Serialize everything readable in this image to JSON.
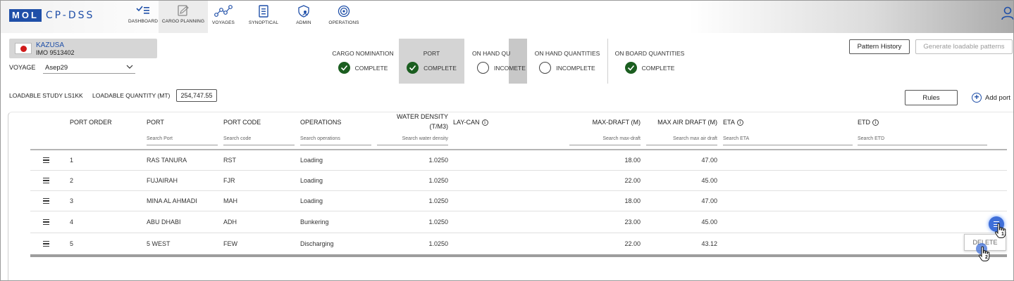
{
  "brand": {
    "logo_box": "MOL",
    "logo_text": "CP-DSS"
  },
  "nav": [
    {
      "label": "DASHBOARD",
      "icon": "checklist-icon"
    },
    {
      "label": "CARGO PLANNING",
      "icon": "clipboard-edit-icon"
    },
    {
      "label": "VOYAGES",
      "icon": "route-nodes-icon"
    },
    {
      "label": "SYNOPTICAL",
      "icon": "report-icon"
    },
    {
      "label": "ADMIN",
      "icon": "shield-user-icon"
    },
    {
      "label": "OPERATIONS",
      "icon": "target-icon"
    }
  ],
  "vessel": {
    "name": "KAZUSA",
    "imo": "IMO 9513402",
    "flag": "japan-flag-icon"
  },
  "voyage": {
    "label": "VOYAGE",
    "value": "Asep29"
  },
  "steps": [
    {
      "title": "CARGO NOMINATION",
      "status": "COMPLETE"
    },
    {
      "title": "PORT",
      "status": "COMPLETE"
    },
    {
      "title": "ON HAND QU",
      "status": "INCOMETE"
    },
    {
      "title": "ON HAND QUANTITIES",
      "status": "INCOMPLETE"
    },
    {
      "title": "ON BOARD QUANTITIES",
      "status": "COMPLETE"
    }
  ],
  "buttons": {
    "pattern_history": "Pattern History",
    "generate": "Generate loadable patterns",
    "rules": "Rules",
    "add_port": "Add port"
  },
  "study": {
    "label": "LOADABLE STUDY LS1KK",
    "quantity_label": "LOADABLE QUANTITY (MT)",
    "quantity_value": "254,747.55"
  },
  "columns": {
    "port_order": "PORT ORDER",
    "port": "PORT",
    "port_code": "PORT CODE",
    "operations": "OPERATIONS",
    "water_density_1": "WATER DENSITY",
    "water_density_2": "(T/M3)",
    "lay_can": "LAY-CAN",
    "max_draft": "MAX-DRAFT (M)",
    "max_air_draft": "MAX AIR DRAFT (M)",
    "eta": "ETA",
    "etd": "ETD"
  },
  "search": {
    "port": "Search Port",
    "port_code": "Search code",
    "operations": "Search operations",
    "water_density": "Search water density",
    "max_draft": "Search max-draft",
    "max_air_draft": "Search max air draft",
    "eta": "Search ETA",
    "etd": "Search ETD"
  },
  "rows": [
    {
      "order": "1",
      "port": "RAS TANURA",
      "code": "RST",
      "operation": "Loading",
      "density": "1.0250",
      "max_draft": "18.00",
      "air_draft": "47.00"
    },
    {
      "order": "2",
      "port": "FUJAIRAH",
      "code": "FJR",
      "operation": "Loading",
      "density": "1.0250",
      "max_draft": "22.00",
      "air_draft": "45.00"
    },
    {
      "order": "3",
      "port": "MINA AL AHMADI",
      "code": "MAH",
      "operation": "Loading",
      "density": "1.0250",
      "max_draft": "18.00",
      "air_draft": "47.00"
    },
    {
      "order": "4",
      "port": "ABU DHABI",
      "code": "ADH",
      "operation": "Bunkering",
      "density": "1.0250",
      "max_draft": "23.00",
      "air_draft": "45.00"
    },
    {
      "order": "5",
      "port": "5 WEST",
      "code": "FEW",
      "operation": "Discharging",
      "density": "1.0250",
      "max_draft": "22.00",
      "air_draft": "43.12"
    }
  ],
  "context_menu": {
    "delete": "DELETE"
  },
  "cursors": [
    {
      "step": "1"
    },
    {
      "step": "2"
    }
  ],
  "colors": {
    "brand_blue": "#1f4fa8",
    "complete_green": "#1b5e20",
    "highlight_blue": "#3f6fd8"
  }
}
